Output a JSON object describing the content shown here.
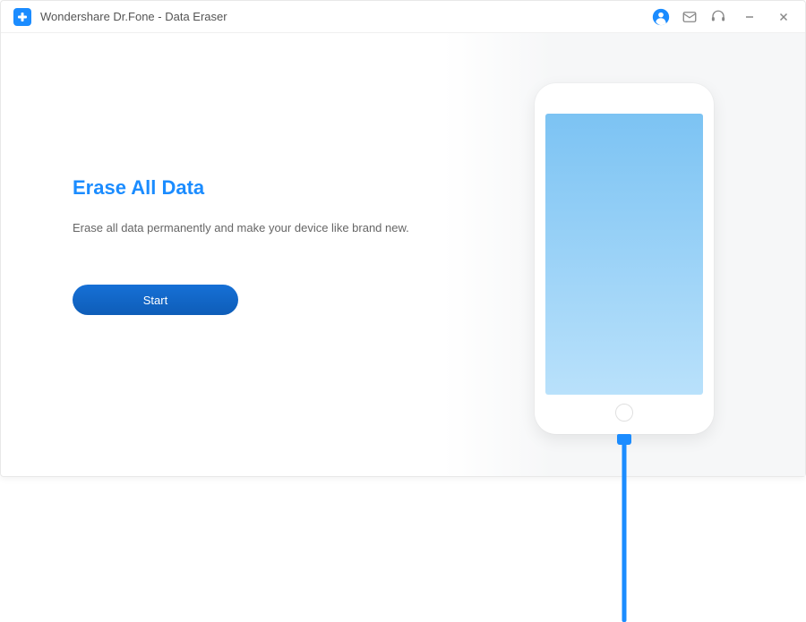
{
  "titlebar": {
    "title": "Wondershare Dr.Fone - Data Eraser"
  },
  "main": {
    "heading": "Erase All Data",
    "subtext": "Erase all data permanently and make your device like brand new.",
    "start_label": "Start"
  },
  "colors": {
    "accent": "#1b8cff",
    "button": "#0f66c7"
  }
}
